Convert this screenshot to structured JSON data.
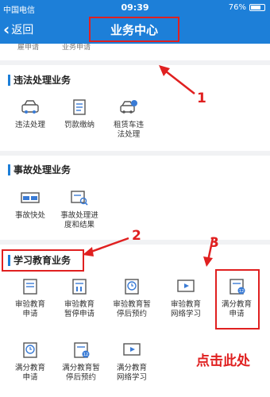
{
  "status_bar": {
    "carrier": "中国电信",
    "time": "09:39",
    "battery": "76%",
    "battery_level": 0.76
  },
  "nav": {
    "back_label": "返回",
    "title": "业务中心"
  },
  "partial_row": [
    "雇申请",
    "业务申请"
  ],
  "sections": {
    "violation": {
      "title": "违法处理业务",
      "items": [
        {
          "label": "违法处理",
          "icon": "car-icon"
        },
        {
          "label": "罚款缴纳",
          "icon": "scroll-icon"
        },
        {
          "label": "租赁车违\n法处理",
          "icon": "rental-car-icon"
        }
      ]
    },
    "accident": {
      "title": "事故处理业务",
      "items": [
        {
          "label": "事故快处",
          "icon": "collision-icon"
        },
        {
          "label": "事故处理进\n度和结果",
          "icon": "progress-search-icon"
        }
      ]
    },
    "education": {
      "title": "学习教育业务",
      "items": [
        {
          "label": "审验教育\n申请",
          "icon": "document-icon"
        },
        {
          "label": "审验教育\n暂停申请",
          "icon": "document-pause-icon"
        },
        {
          "label": "审验教育暂\n停后预约",
          "icon": "clock-document-icon"
        },
        {
          "label": "审验教育\n网络学习",
          "icon": "video-icon"
        },
        {
          "label": "满分教育\n申请",
          "icon": "document-12-icon"
        },
        {
          "label": "满分教育\n申请",
          "icon": "clock-document-icon"
        },
        {
          "label": "满分教育暂\n停后预约",
          "icon": "document-12-icon"
        },
        {
          "label": "满分教育\n网络学习",
          "icon": "video-icon"
        }
      ]
    }
  },
  "annotations": {
    "num1": "1",
    "num2": "2",
    "num3": "3",
    "click_here": "点击此处"
  },
  "colors": {
    "brand": "#1d7fd8",
    "annotation": "#e02020",
    "icon_accent": "#3a7bd5"
  }
}
